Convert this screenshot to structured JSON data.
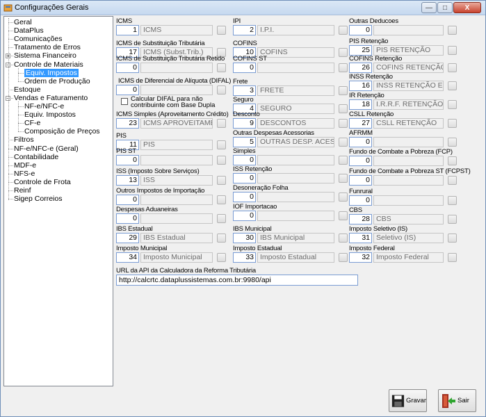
{
  "window": {
    "title": "Configurações Gerais",
    "minimize": "—",
    "maximize": "□",
    "close": "X"
  },
  "tree": [
    {
      "label": "Geral",
      "level": 0,
      "expand": false
    },
    {
      "label": "DataPlus",
      "level": 0,
      "expand": false
    },
    {
      "label": "Comunicações",
      "level": 0,
      "expand": false
    },
    {
      "label": "Tratamento de Erros",
      "level": 0,
      "expand": false
    },
    {
      "label": "Sistema Financeiro",
      "level": 0,
      "expand": true,
      "expand_sign": "+"
    },
    {
      "label": "Controle de Materiais",
      "level": 0,
      "expand": true,
      "expand_sign": "−"
    },
    {
      "label": "Equiv. Impostos",
      "level": 1,
      "selected": true
    },
    {
      "label": "Ordem de Produção",
      "level": 1
    },
    {
      "label": "Estoque",
      "level": 0
    },
    {
      "label": "Vendas e Faturamento",
      "level": 0,
      "expand": true,
      "expand_sign": "−"
    },
    {
      "label": "NF-e/NFC-e",
      "level": 1
    },
    {
      "label": "Equiv. Impostos",
      "level": 1
    },
    {
      "label": "CF-e",
      "level": 1
    },
    {
      "label": "Composição de Preços",
      "level": 1
    },
    {
      "label": "Filtros",
      "level": 0
    },
    {
      "label": "NF-e/NFC-e (Geral)",
      "level": 0
    },
    {
      "label": "Contabilidade",
      "level": 0
    },
    {
      "label": "MDF-e",
      "level": 0
    },
    {
      "label": "NFS-e",
      "level": 0
    },
    {
      "label": "Controle de Frota",
      "level": 0
    },
    {
      "label": "Reinf",
      "level": 0
    },
    {
      "label": "Sigep Correios",
      "level": 0
    }
  ],
  "columns": [
    [
      {
        "label": "ICMS",
        "code": "1",
        "desc": "ICMS"
      },
      {
        "label": "ICMS de Substituição Tributária",
        "code": "17",
        "desc": "ICMS (Subst.Trib.)"
      },
      {
        "label": "ICMS de Substituição Tributária Retido",
        "code": "0",
        "desc": ""
      },
      {
        "label": "ICMS de Diferencial de Alíquota (DIFAL)",
        "code": "0",
        "desc": ""
      },
      {
        "label": "ICMS Simples (Aproveitamento Crédito)",
        "code": "23",
        "desc": "ICMS APROVEITAMENT"
      },
      {
        "label": "PIS",
        "code": "11",
        "desc": "PIS"
      },
      {
        "label": "PIS ST",
        "code": "0",
        "desc": ""
      },
      {
        "label": "ISS (Imposto Sobre Serviços)",
        "code": "13",
        "desc": "ISS"
      },
      {
        "label": "Outros Impostos de Importação",
        "code": "0",
        "desc": ""
      },
      {
        "label": "Despesas Aduaneiras",
        "code": "0",
        "desc": ""
      },
      {
        "label": "IBS Estadual",
        "code": "29",
        "desc": "IBS Estadual"
      },
      {
        "label": "Imposto Municipal",
        "code": "34",
        "desc": "Imposto Municipal"
      }
    ],
    [
      {
        "label": "IPI",
        "code": "2",
        "desc": "I.P.I."
      },
      {
        "label": "COFINS",
        "code": "10",
        "desc": "COFINS"
      },
      {
        "label": "COFINS ST",
        "code": "0",
        "desc": ""
      },
      {
        "label": "Frete",
        "code": "3",
        "desc": "FRETE"
      },
      {
        "label": "Seguro",
        "code": "4",
        "desc": "SEGURO"
      },
      {
        "label": "Desconto",
        "code": "9",
        "desc": "DESCONTOS"
      },
      {
        "label": "Outras Despesas Acessorias",
        "code": "5",
        "desc": "OUTRAS DESP. ACESSO"
      },
      {
        "label": "Simples",
        "code": "0",
        "desc": ""
      },
      {
        "label": "ISS Retenção",
        "code": "0",
        "desc": ""
      },
      {
        "label": "Desoneração Folha",
        "code": "0",
        "desc": ""
      },
      {
        "label": "IOF Importacao",
        "code": "0",
        "desc": ""
      },
      {
        "label": "IBS Municipal",
        "code": "30",
        "desc": "IBS Municipal"
      },
      {
        "label": "Imposto Estadual",
        "code": "33",
        "desc": "Imposto Estadual"
      }
    ],
    [
      {
        "label": "Outras Deducoes",
        "code": "0",
        "desc": ""
      },
      {
        "label": "PIS Retenção",
        "code": "25",
        "desc": "PIS RETENÇÃO"
      },
      {
        "label": "COFINS Retenção",
        "code": "26",
        "desc": "COFINS RETENÇÃO"
      },
      {
        "label": "INSS Retenção",
        "code": "16",
        "desc": "INSS RETENÇÃO EMPR"
      },
      {
        "label": "IR Retenção",
        "code": "18",
        "desc": "I.R.R.F. RETENÇÃO"
      },
      {
        "label": "CSLL Retenção",
        "code": "27",
        "desc": "CSLL RETENÇÃO"
      },
      {
        "label": "AFRMM",
        "code": "0",
        "desc": ""
      },
      {
        "label": "Fundo de Combate a Pobreza (FCP)",
        "code": "0",
        "desc": ""
      },
      {
        "label": "Fundo de Combate a Pobreza ST (FCPST)",
        "code": "0",
        "desc": ""
      },
      {
        "label": "Funrural",
        "code": "0",
        "desc": ""
      },
      {
        "label": "CBS",
        "code": "28",
        "desc": "CBS"
      },
      {
        "label": "Imposto Seletivo (IS)",
        "code": "31",
        "desc": "Seletivo (IS)"
      },
      {
        "label": "Imposto Federal",
        "code": "32",
        "desc": "Imposto Federal"
      }
    ]
  ],
  "difal_checkbox": {
    "label_line1": "Calcular DIFAL para não",
    "label_line2": "contribuinte com Base Dupla",
    "checked": false
  },
  "url": {
    "label": "URL da API da Calculadora da Reforma Tributária",
    "value": "http://calcrtc.dataplussistemas.com.br:9980/api"
  },
  "buttons": {
    "save": "Gravar",
    "exit": "Sair"
  }
}
